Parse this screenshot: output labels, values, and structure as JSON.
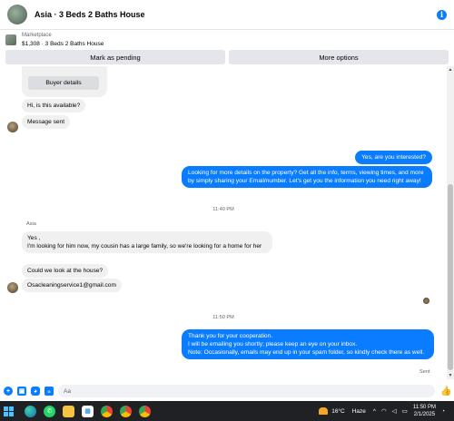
{
  "header": {
    "title": "Asia · 3 Beds 2 Baths House",
    "info_icon": "info-icon"
  },
  "listing": {
    "source": "Marketplace",
    "price_title": "$1,308 · 3 Beds 2 Baths House"
  },
  "actions": {
    "mark_pending": "Mark as pending",
    "more_options": "More options"
  },
  "chat": {
    "buyer_details": "Buyer details",
    "messages_top": [
      {
        "text": "Hi, is this available?"
      },
      {
        "text": "Message sent"
      }
    ],
    "outgoing_1": [
      {
        "text": "Yes, are you interested?"
      },
      {
        "text": "Looking for more details on the property? Get all the info, terms, viewing times, and more by simply sharing your Email/number. Let's get you the information you need right away!"
      }
    ],
    "time_1": "11:40 PM",
    "sender_name": "Asia",
    "incoming_2": [
      {
        "text": "Yes ,\nI'm looking for him now, my cousin has a large family, so we're looking for a home for her"
      },
      {
        "text": "Could we look at the house?"
      },
      {
        "text": "Osacleaningservice1@gmail.com"
      }
    ],
    "time_2": "11:50 PM",
    "outgoing_2": "Thank you for your cooperation.\nI will be emailing you shortly; please keep an eye on your inbox.\nNote: Occasionally, emails may end up in your spam folder, so kindly check there as well.",
    "status": "Sent"
  },
  "composer": {
    "placeholder": "Aa"
  },
  "taskbar": {
    "temperature": "16°C",
    "weather": "Haze",
    "time": "11:50 PM",
    "date": "2/1/2025"
  },
  "colors": {
    "accent": "#0a7cff",
    "incoming_bubble": "#f0f0f0",
    "taskbar": "#202124"
  }
}
